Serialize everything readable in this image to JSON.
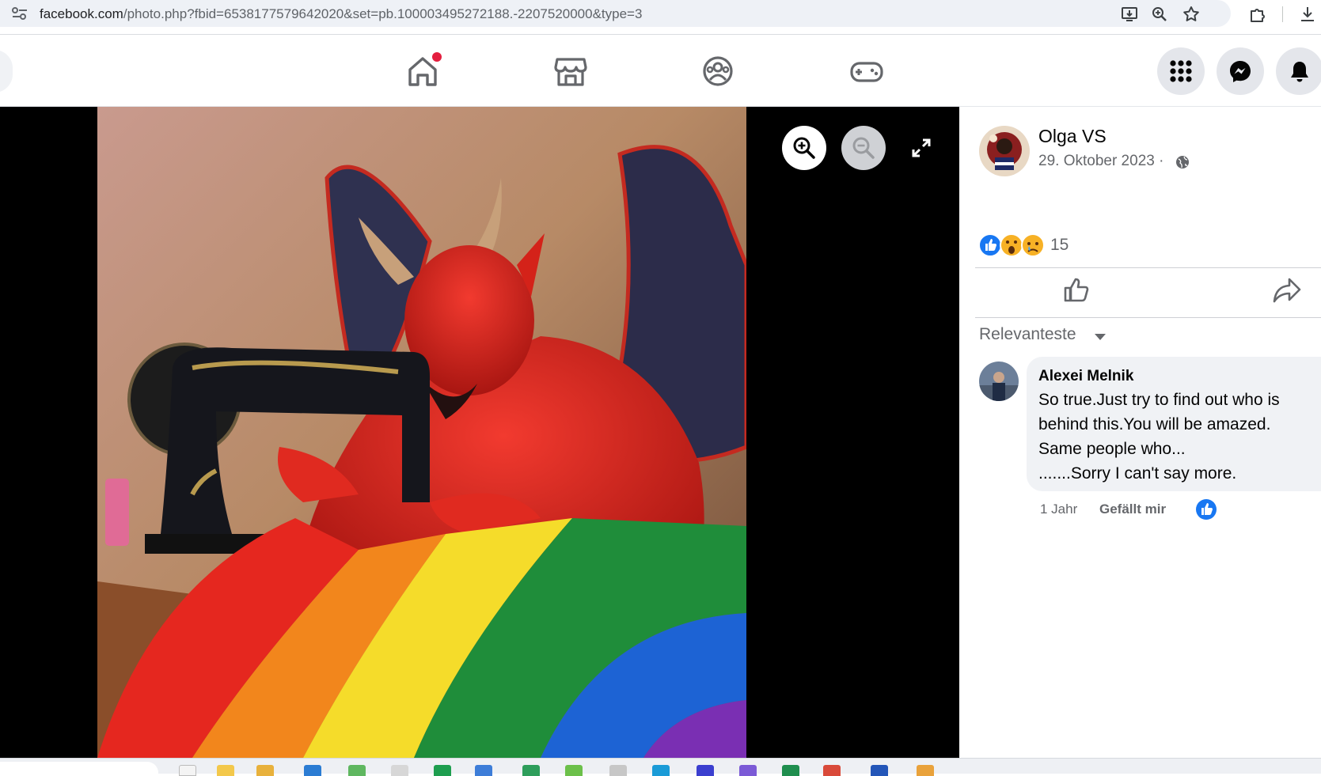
{
  "browser": {
    "url_domain": "facebook.com",
    "url_path": "/photo.php?fbid=6538177579642020&set=pb.100003495272188.-2207520000&type=3"
  },
  "nav": {
    "tabs": [
      "home",
      "marketplace",
      "groups",
      "gaming"
    ],
    "home_has_notification": true
  },
  "post": {
    "author": "Olga VS",
    "date": "29. Oktober 2023 ·",
    "reactions_count": "15",
    "sort_label": "Relevanteste"
  },
  "comment": {
    "author": "Alexei Melnik",
    "lines": [
      "So true.Just try to find out who is",
      "behind this.You will be amazed.",
      "Same people who...",
      ".......Sorry I can't say more."
    ],
    "time": "1 Jahr",
    "like_label": "Gefällt mir"
  },
  "colors": {
    "brand_blue": "#0866ff",
    "notification_red": "#e41e3f",
    "secondary_text": "#65676b"
  }
}
